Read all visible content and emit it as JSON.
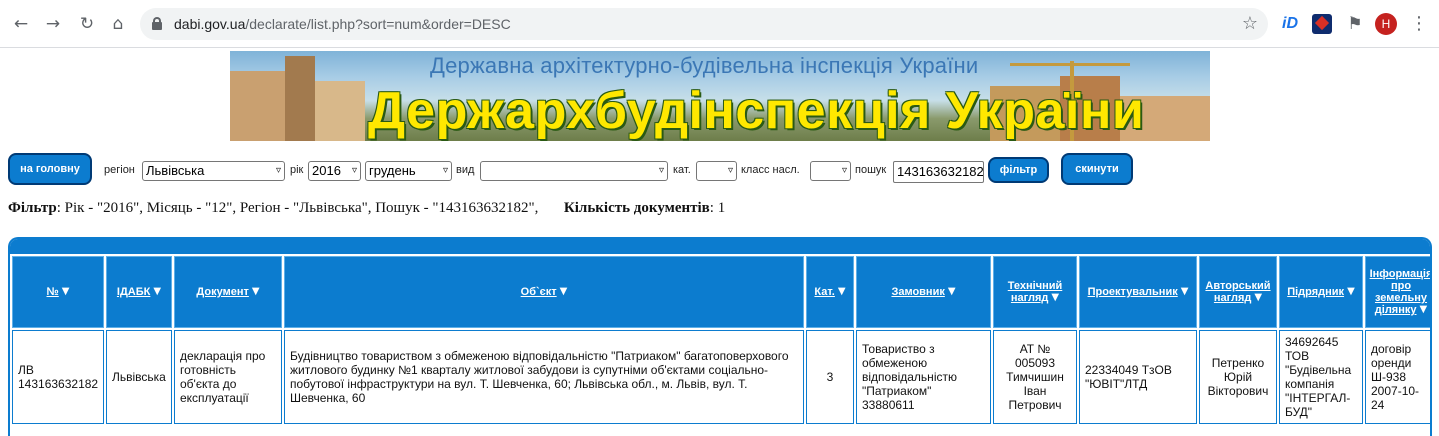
{
  "browser": {
    "url_host": "dabi.gov.ua",
    "url_path": "/declarate/list.php?sort=num&order=DESC",
    "avatar_letter": "H",
    "ext_id_label": "iD"
  },
  "banner": {
    "subtitle": "Державна архітектурно-будівельна інспекція України",
    "title": "Держархбудінспекція України"
  },
  "filters": {
    "home_button": "на головну",
    "region_label": "регіон",
    "region_value": "Львівська",
    "year_label": "рік",
    "year_value": "2016",
    "month_value": "грудень",
    "kind_label": "вид",
    "kind_value": "",
    "cat_label": "кат.",
    "cat_value": "",
    "class_label": "класс насл.",
    "class_value": "",
    "search_label": "пошук",
    "search_value": "143163632182",
    "filter_button": "фільтр",
    "reset_button": "скинути"
  },
  "summary": {
    "filter_label": "Фільтр",
    "filter_text": ": Рік - \"2016\", Місяць - \"12\", Регіон - \"Львівська\", Пошук - \"143163632182\",",
    "count_label": "Кількість документів",
    "count_value": ": 1"
  },
  "table": {
    "headers": [
      "№",
      "ІДАБК",
      "Документ",
      "Об`єкт",
      "Кат.",
      "Замовник",
      "Технічний нагляд",
      "Проектувальник",
      "Авторський нагляд",
      "Підрядник",
      "Інформація про земельну ділянку"
    ],
    "rows": [
      {
        "num": "ЛВ 143163632182",
        "idabk": "Львівська",
        "doc": "декларація про готовність об'єкта до експлуатації",
        "object": "Будівництво товариством з обмеженою відповідальністю \"Патриаком\" багатоповерхового житлового будинку №1 кварталу житлової забудови із супутніми об'єктами соціально-побутової інфраструктури на вул. Т. Шевченка, 60; Львівська обл., м. Львів, вул. Т. Шевченка, 60",
        "cat": "3",
        "customer": "Товариство з обмеженою відповідальністю \"Патриаком\" 33880611",
        "tech": "АТ № 005093 Тимчишин Іван Петрович",
        "designer": "22334049 ТзОВ \"ЮВІТ\"ЛТД",
        "author": "Петренко Юрій Вікторович",
        "contractor": "34692645 ТОВ \"Будівельна компанія \"ІНТЕРГАЛ-БУД\"",
        "land": "договір оренди Ш-938 2007-10-24"
      }
    ]
  },
  "icons": {
    "back": "arrow-left-icon",
    "forward": "arrow-right-icon",
    "reload": "reload-icon",
    "home": "home-icon",
    "lock": "lock-icon",
    "bookmark": "star-icon",
    "extensions": "puzzle-icon",
    "menu": "kebab-icon",
    "sort": "sort-arrow-icon"
  },
  "colors": {
    "accent": "#0c7ccf",
    "banner_title": "#ffe800"
  }
}
